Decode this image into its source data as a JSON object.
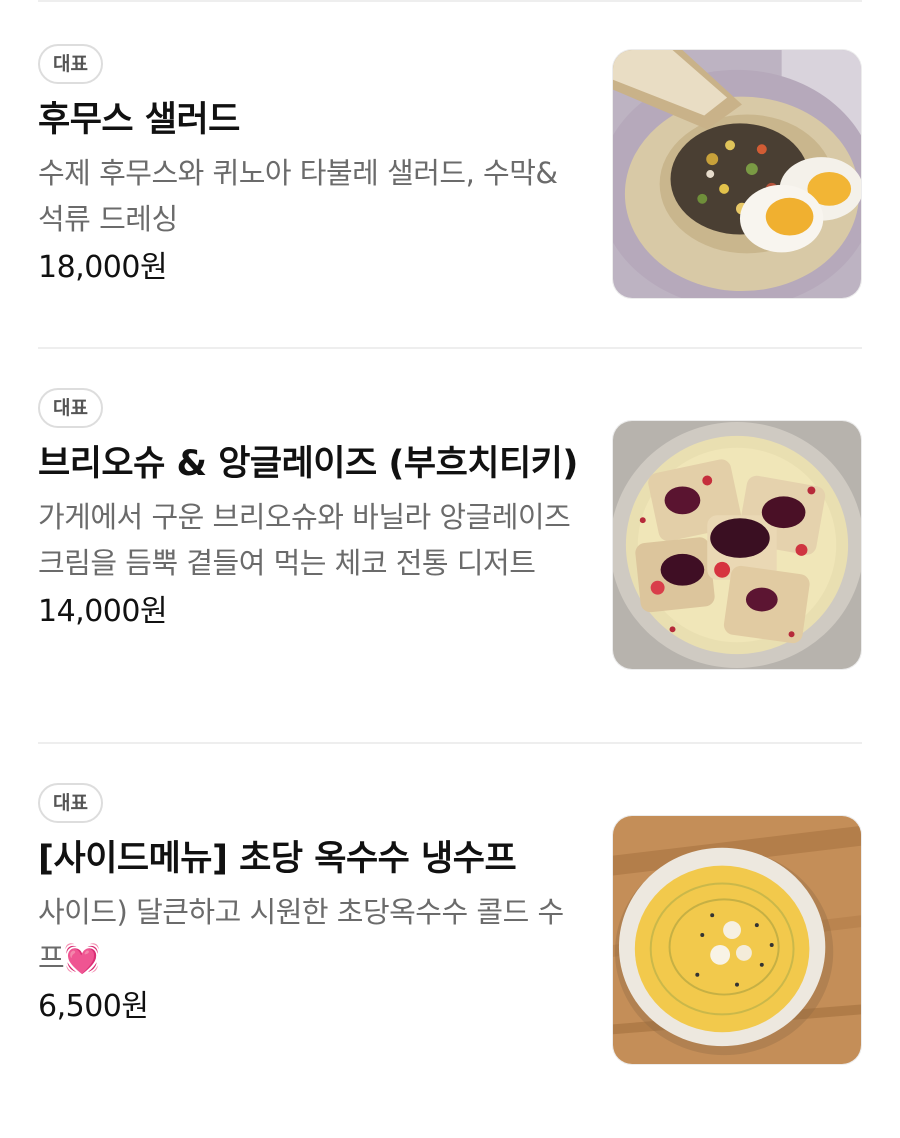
{
  "menu": {
    "items": [
      {
        "badge": "대표",
        "name": "후무스 샐러드",
        "description": "수제 후무스와 퀴노아 타불레 샐러드, 수막& 석류 드레싱",
        "price": "18,000원",
        "image": "hummus-salad-photo"
      },
      {
        "badge": "대표",
        "name": "브리오슈 & 앙글레이즈 (부흐치티키)",
        "description": "가게에서 구운 브리오슈와 바닐라 앙글레이즈 크림을 듬뿍 곁들여 먹는 체코 전통 디저트",
        "price": "14,000원",
        "image": "brioche-anglaise-photo"
      },
      {
        "badge": "대표",
        "name": "[사이드메뉴] 초당 옥수수 냉수프",
        "description": "사이드) 달큰하고 시원한 초당옥수수 콜드 수프💓",
        "price": "6,500원",
        "image": "corn-cold-soup-photo"
      }
    ]
  }
}
